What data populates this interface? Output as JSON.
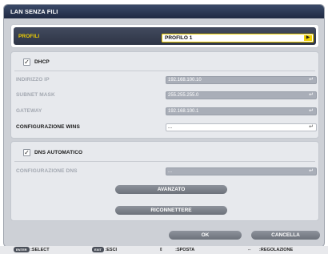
{
  "window": {
    "title": "LAN SENZA FILI"
  },
  "profile": {
    "label": "PROFILI",
    "value": "PROFILO 1",
    "arrow_icon": "▶"
  },
  "dhcp": {
    "label": "DHCP",
    "checked": "✓"
  },
  "ip": {
    "label": "INDIRIZZO IP",
    "value": "192.168.100.10"
  },
  "subnet": {
    "label": "SUBNET MASK",
    "value": "255.255.255.0"
  },
  "gateway": {
    "label": "GATEWAY",
    "value": "192.168.100.1"
  },
  "wins": {
    "label": "CONFIGURAZIONE WINS",
    "value": "..."
  },
  "dns_auto": {
    "label": "DNS AUTOMATICO",
    "checked": "✓"
  },
  "dns": {
    "label": "CONFIGURAZIONE DNS",
    "value": "..."
  },
  "enter_icon": "↵",
  "buttons": {
    "advanced": "AVANZATO",
    "reconnect": "RICONNETTERE",
    "ok": "OK",
    "cancel": "CANCELLA"
  },
  "footer": {
    "enter_key": "ENTER",
    "select": ":SELECT",
    "exit_key": "EXIT",
    "exit": ":ESCI",
    "updown_icon": "⇕",
    "move": ":SPOSTA",
    "leftright_icon": "⇔",
    "adjust": ":REGOLAZIONE"
  }
}
